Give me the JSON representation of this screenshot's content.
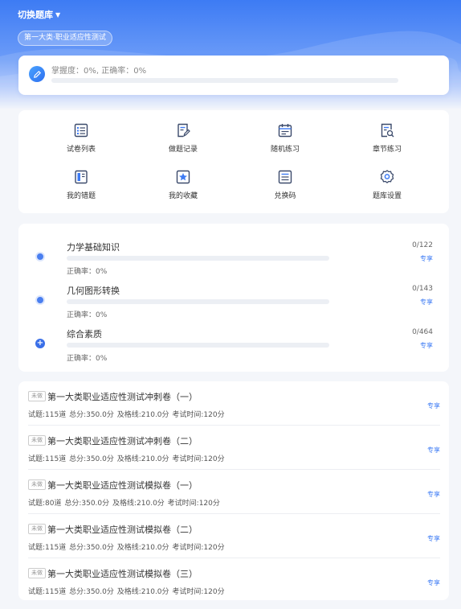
{
  "header": {
    "switch_label": "切换题库",
    "switch_caret": "▼",
    "category_tag": "第一大类·职业适应性测试"
  },
  "mastery": {
    "icon": "pencil-icon",
    "text": "掌握度：0%, 正确率：0%",
    "progress": 0
  },
  "menu": [
    {
      "label": "试卷列表",
      "icon": "paper-list-icon"
    },
    {
      "label": "做题记录",
      "icon": "record-icon"
    },
    {
      "label": "随机练习",
      "icon": "calendar-icon"
    },
    {
      "label": "章节练习",
      "icon": "chapter-search-icon"
    },
    {
      "label": "我的错题",
      "icon": "wrong-book-icon"
    },
    {
      "label": "我的收藏",
      "icon": "star-icon"
    },
    {
      "label": "兑换码",
      "icon": "list-icon"
    },
    {
      "label": "题库设置",
      "icon": "gear-icon"
    }
  ],
  "subjects": [
    {
      "title": "力学基础知识",
      "rate": "正确率：0%",
      "count": "0/122",
      "action": "专享",
      "progress": 0
    },
    {
      "title": "几何图形转换",
      "rate": "正确率：0%",
      "count": "0/143",
      "action": "专享",
      "progress": 0
    },
    {
      "title": "综合素质",
      "rate": "正确率：0%",
      "count": "0/464",
      "action": "专享",
      "progress": 0
    }
  ],
  "papers": [
    {
      "badge": "未做",
      "title": "第一大类职业适应性测试冲刺卷（一）",
      "meta": "试题:115道  总分:350.0分  及格线:210.0分  考试时间:120分",
      "action": "专享"
    },
    {
      "badge": "未做",
      "title": "第一大类职业适应性测试冲刺卷（二）",
      "meta": "试题:115道  总分:350.0分  及格线:210.0分  考试时间:120分",
      "action": "专享"
    },
    {
      "badge": "未做",
      "title": "第一大类职业适应性测试模拟卷（一）",
      "meta": "试题:80道  总分:350.0分  及格线:210.0分  考试时间:120分",
      "action": "专享"
    },
    {
      "badge": "未做",
      "title": "第一大类职业适应性测试模拟卷（二）",
      "meta": "试题:115道  总分:350.0分  及格线:210.0分  考试时间:120分",
      "action": "专享"
    },
    {
      "badge": "未做",
      "title": "第一大类职业适应性测试模拟卷（三）",
      "meta": "试题:115道  总分:350.0分  及格线:210.0分  考试时间:120分",
      "action": "专享"
    }
  ],
  "colors": {
    "accent": "#3d7bf4"
  }
}
